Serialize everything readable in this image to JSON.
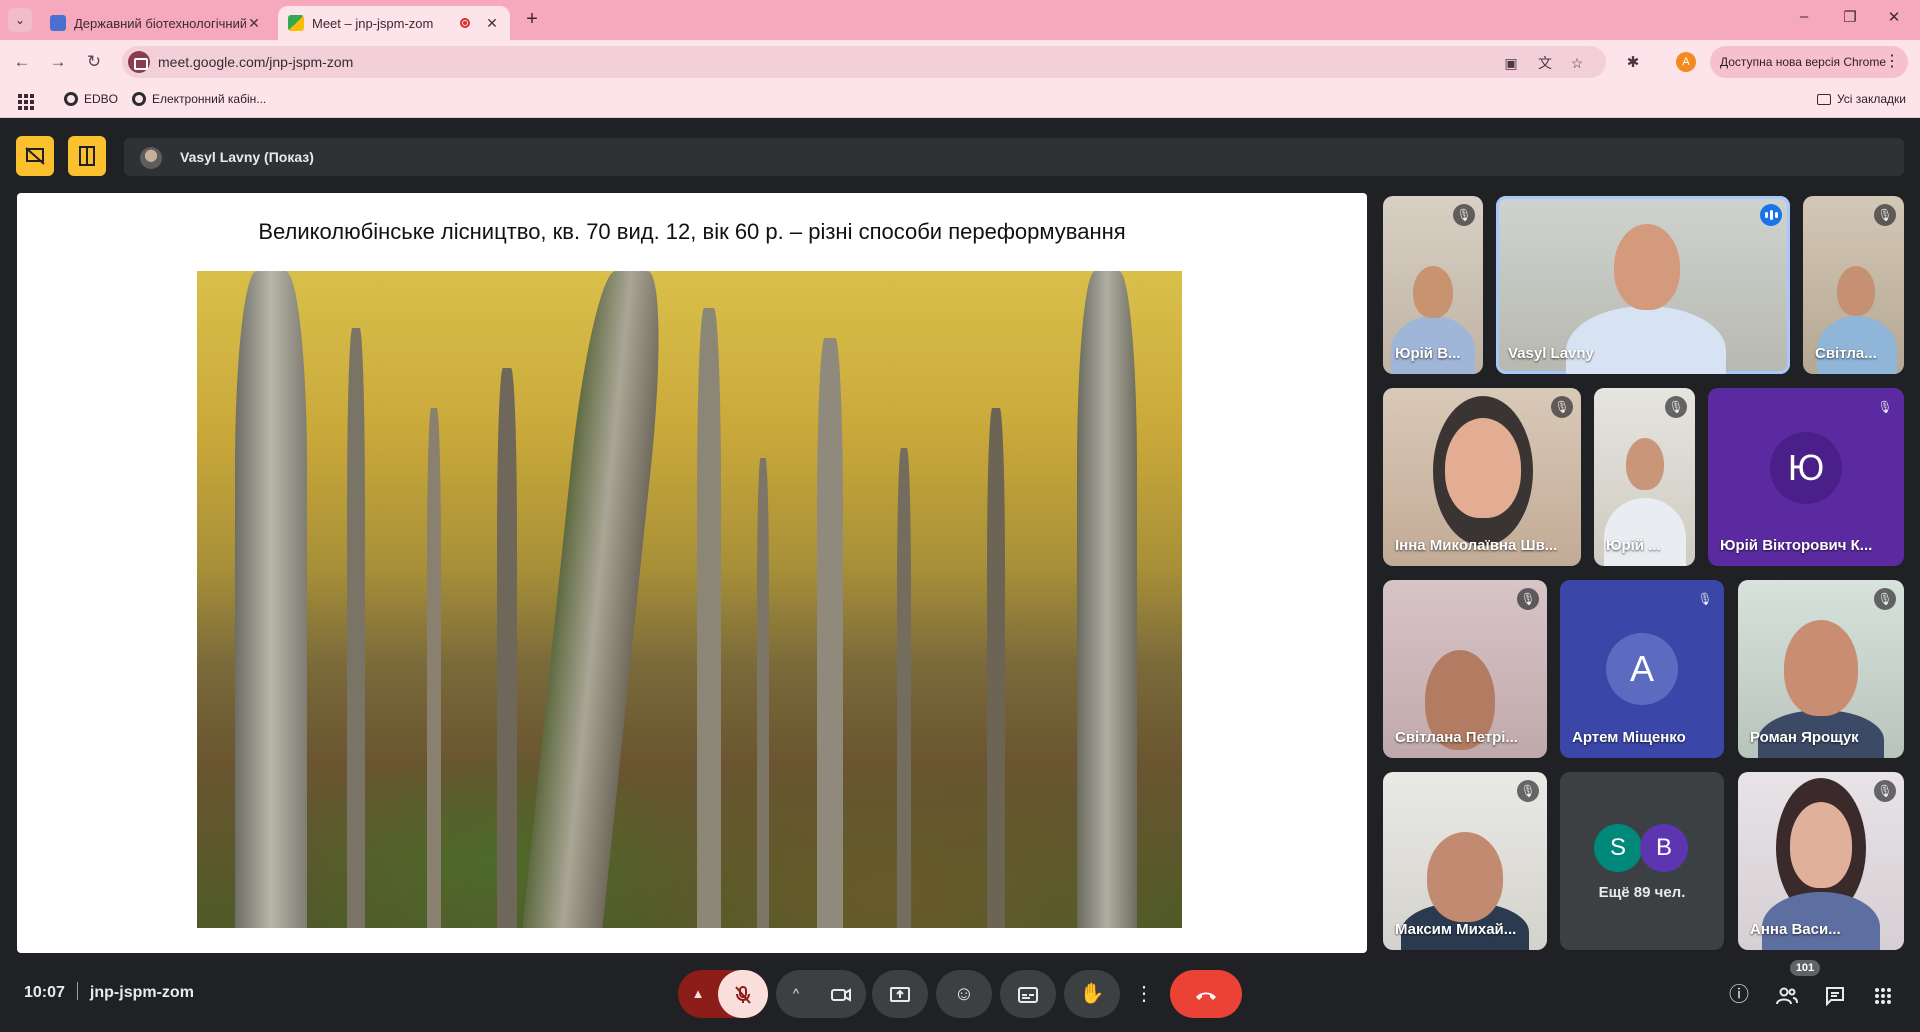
{
  "browser": {
    "tabs": [
      {
        "title": "Державний біотехнологічний",
        "active": false
      },
      {
        "title": "Meet – jnp-jspm-zom",
        "active": true
      }
    ],
    "url": "meet.google.com/jnp-jspm-zom",
    "profile_initial": "A",
    "update_chip": "Доступна нова версія Chrome",
    "bookmarks": [
      {
        "label": "EDBO"
      },
      {
        "label": "Електронний кабін..."
      }
    ],
    "all_bookmarks": "Усі закладки"
  },
  "meet": {
    "presenter_bar": "Vasyl Lavny (Показ)",
    "slide_title": "Великолюбінське лісництво, кв. 70 вид. 12, вік 60 р. – різні способи переформування",
    "participants": [
      {
        "name": "Юрій В...",
        "muted": true
      },
      {
        "name": "Vasyl Lavny",
        "speaking": true
      },
      {
        "name": "Світла...",
        "muted": true
      },
      {
        "name": "Інна Миколаївна Шв...",
        "muted": true
      },
      {
        "name": "Юрій ...",
        "muted": true
      },
      {
        "name": "Юрій Вікторович К...",
        "initial": "Ю",
        "muted": true
      },
      {
        "name": "Світлана Петрі...",
        "muted": true
      },
      {
        "name": "Артем Міщенко",
        "initial": "А",
        "muted": true
      },
      {
        "name": "Роман Ярощук",
        "muted": true
      },
      {
        "name": "Максим Михай...",
        "muted": true
      },
      {
        "name": "Анна Васи...",
        "muted": true
      }
    ],
    "more_tile": {
      "avatars": [
        "S",
        "B"
      ],
      "text": "Ещё 89 чел."
    },
    "time": "10:07",
    "meeting_code": "jnp-jspm-zom",
    "people_count": "101"
  },
  "colors": {
    "tab_strip": "#f6a9bd",
    "toolbar": "#fde3ea",
    "meet_bg": "#202124",
    "end_call": "#ea4335",
    "accent_yellow": "#fbc02d"
  },
  "icons": {
    "mic_muted": "mic-off-icon",
    "camera": "camera-icon",
    "present": "present-icon",
    "emoji": "emoji-icon",
    "captions": "captions-icon",
    "hand": "raise-hand-icon",
    "more": "more-vert-icon",
    "end_call": "end-call-icon",
    "info": "info-icon",
    "people": "people-icon",
    "chat": "chat-icon",
    "activities": "apps-grid-icon"
  }
}
